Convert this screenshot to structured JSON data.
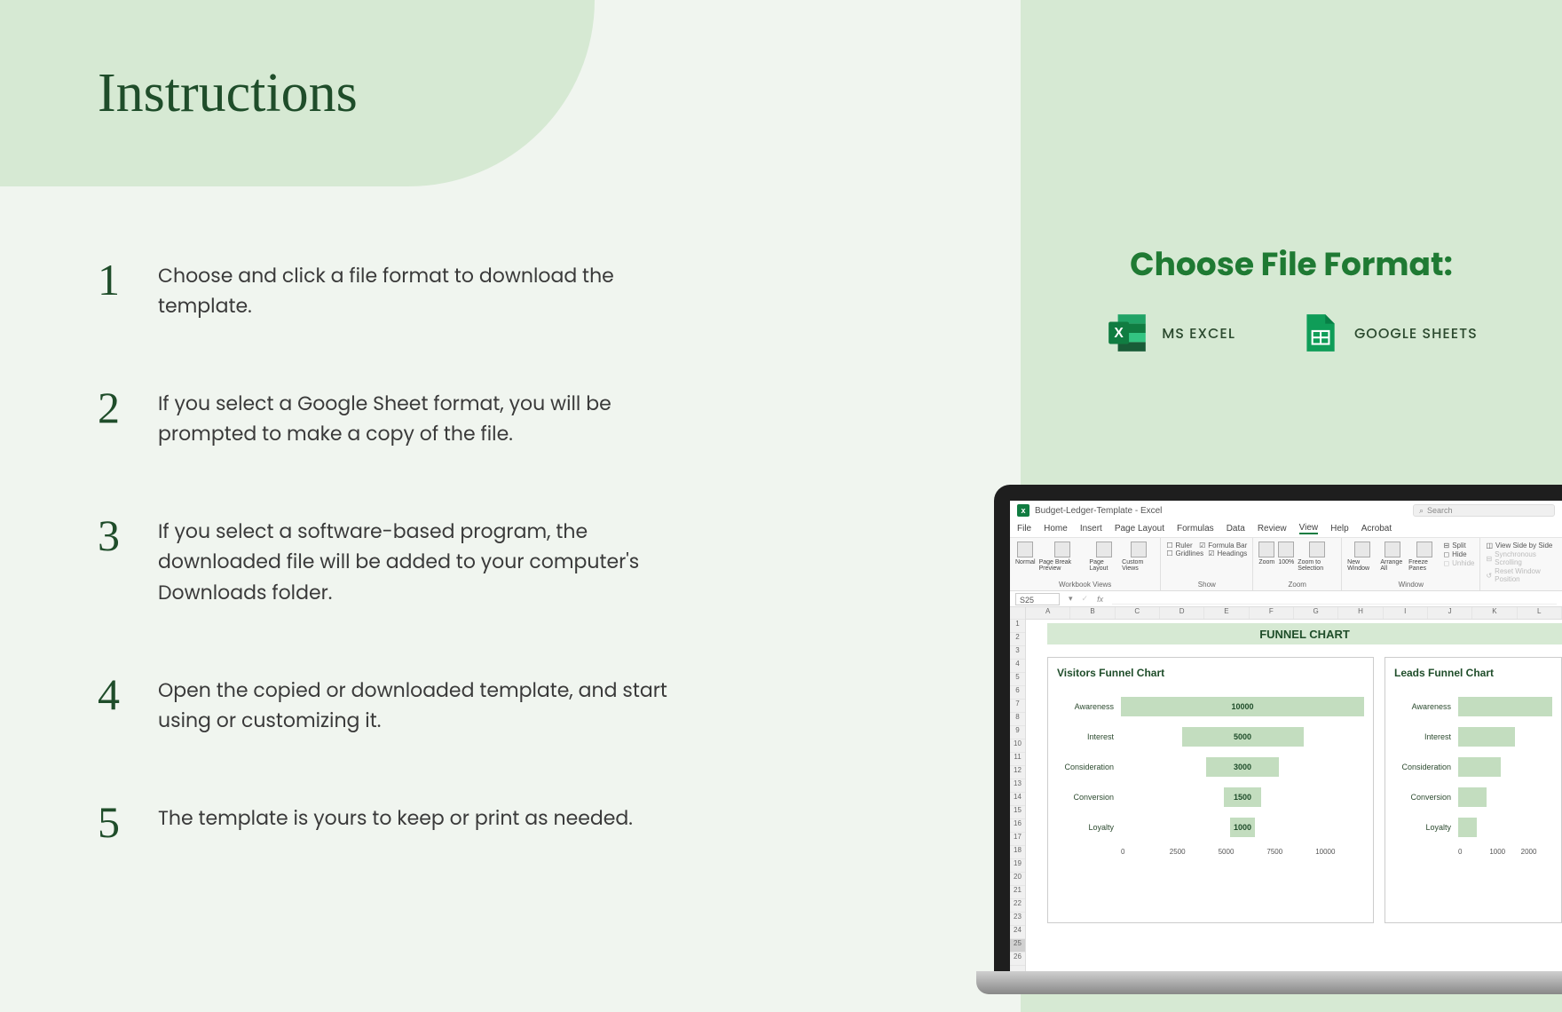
{
  "title": "Instructions",
  "steps": [
    "Choose and click a file format to download the template.",
    "If you select a Google Sheet format, you will be prompted to make a copy of the file.",
    "If you select a software-based program, the downloaded file will be added to your computer's Downloads folder.",
    "Open the copied or downloaded template, and start using or customizing it.",
    "The template is yours to keep or print as needed."
  ],
  "right": {
    "heading": "Choose File Format:",
    "options": [
      {
        "label": "MS EXCEL"
      },
      {
        "label": "GOOGLE SHEETS"
      }
    ]
  },
  "excel": {
    "titlebar": "Budget-Ledger-Template - Excel",
    "search_placeholder": "Search",
    "menus": [
      "File",
      "Home",
      "Insert",
      "Page Layout",
      "Formulas",
      "Data",
      "Review",
      "View",
      "Help",
      "Acrobat"
    ],
    "ribbon": {
      "group1": {
        "items": [
          "Normal",
          "Page Break Preview",
          "Page Layout",
          "Custom Views"
        ],
        "label": "Workbook Views"
      },
      "group2": {
        "checks": [
          "Ruler",
          "Formula Bar",
          "Gridlines",
          "Headings"
        ],
        "label": "Show"
      },
      "group3": {
        "items": [
          "Zoom",
          "100%",
          "Zoom to Selection"
        ],
        "label": "Zoom"
      },
      "group4": {
        "items": [
          "New Window",
          "Arrange All",
          "Freeze Panes"
        ],
        "extras": [
          "Split",
          "Hide",
          "Unhide"
        ],
        "label": "Window"
      },
      "group5": {
        "items": [
          "View Side by Side",
          "Synchronous Scrolling",
          "Reset Window Position"
        ]
      }
    },
    "cell_ref": "S25",
    "fx_label": "fx",
    "columns": [
      "A",
      "B",
      "C",
      "D",
      "E",
      "F",
      "G",
      "H",
      "I",
      "J",
      "K",
      "L"
    ],
    "banner": "FUNNEL CHART",
    "charts": {
      "visitors": {
        "title": "Visitors Funnel Chart",
        "stages": [
          "Awareness",
          "Interest",
          "Consideration",
          "Conversion",
          "Loyalty"
        ],
        "values": [
          10000,
          5000,
          3000,
          1500,
          1000
        ],
        "axis": [
          "0",
          "2500",
          "5000",
          "7500",
          "10000"
        ]
      },
      "leads": {
        "title": "Leads Funnel Chart",
        "stages": [
          "Awareness",
          "Interest",
          "Consideration",
          "Conversion",
          "Loyalty"
        ],
        "axis": [
          "0",
          "1000",
          "2000"
        ]
      }
    }
  },
  "chart_data": [
    {
      "type": "bar",
      "title": "Visitors Funnel Chart",
      "categories": [
        "Awareness",
        "Interest",
        "Consideration",
        "Conversion",
        "Loyalty"
      ],
      "values": [
        10000,
        5000,
        3000,
        1500,
        1000
      ],
      "xlabel": "",
      "ylabel": "",
      "xlim": [
        0,
        10000
      ]
    },
    {
      "type": "bar",
      "title": "Leads Funnel Chart",
      "categories": [
        "Awareness",
        "Interest",
        "Consideration",
        "Conversion",
        "Loyalty"
      ],
      "values": [],
      "xlabel": "",
      "ylabel": "",
      "xlim": [
        0,
        2000
      ]
    }
  ]
}
